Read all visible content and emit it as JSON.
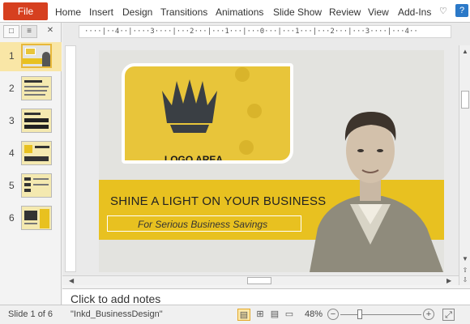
{
  "ribbon": {
    "file": "File",
    "tabs": [
      "Home",
      "Insert",
      "Design",
      "Transitions",
      "Animations",
      "Slide Show",
      "Review",
      "View",
      "Add-Ins"
    ],
    "help": "?"
  },
  "slides_pane": {
    "close": "✕",
    "thumbnails": [
      {
        "number": "1",
        "selected": true
      },
      {
        "number": "2",
        "selected": false
      },
      {
        "number": "3",
        "selected": false
      },
      {
        "number": "4",
        "selected": false
      },
      {
        "number": "5",
        "selected": false
      },
      {
        "number": "6",
        "selected": false
      }
    ]
  },
  "ruler": {
    "marks": "····|··4··|····3····|···2···|···1···|···0···|···1···|···2···|···3····|···4··"
  },
  "slide": {
    "logo_text": "LOGO AREA",
    "headline": "SHINE A LIGHT ON YOUR BUSINESS",
    "subheadline": "For Serious Business Savings",
    "accent_color": "#e8c120"
  },
  "notes": {
    "placeholder": "Click to add notes"
  },
  "statusbar": {
    "slide_info": "Slide 1 of 6",
    "theme": "\"Inkd_BusinessDesign\"",
    "zoom": "48%",
    "zoom_out": "−",
    "zoom_in": "+"
  }
}
